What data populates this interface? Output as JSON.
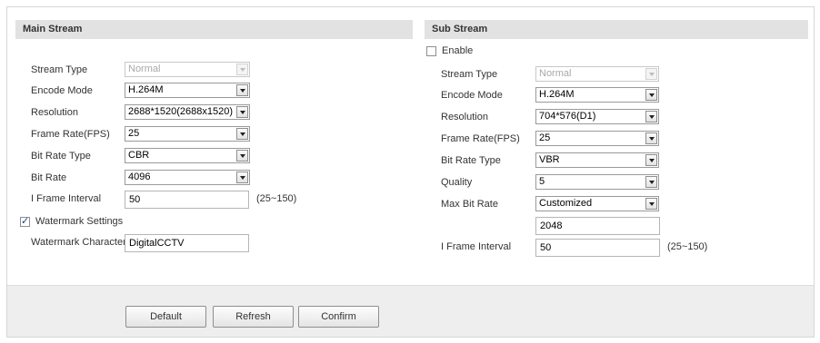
{
  "main_stream": {
    "title": "Main Stream",
    "stream_type": {
      "label": "Stream Type",
      "value": "Normal"
    },
    "encode_mode": {
      "label": "Encode Mode",
      "value": "H.264M"
    },
    "resolution": {
      "label": "Resolution",
      "value": "2688*1520(2688x1520)"
    },
    "frame_rate": {
      "label": "Frame Rate(FPS)",
      "value": "25"
    },
    "bit_rate_type": {
      "label": "Bit Rate Type",
      "value": "CBR"
    },
    "bit_rate": {
      "label": "Bit Rate",
      "value": "4096"
    },
    "i_frame_interval": {
      "label": "I Frame Interval",
      "value": "50",
      "range": "(25~150)"
    },
    "watermark_settings": {
      "label": "Watermark Settings",
      "checked": true
    },
    "watermark_character": {
      "label": "Watermark Character",
      "value": "DigitalCCTV"
    }
  },
  "sub_stream": {
    "title": "Sub Stream",
    "enable": {
      "label": "Enable",
      "checked": false
    },
    "stream_type": {
      "label": "Stream Type",
      "value": "Normal"
    },
    "encode_mode": {
      "label": "Encode Mode",
      "value": "H.264M"
    },
    "resolution": {
      "label": "Resolution",
      "value": "704*576(D1)"
    },
    "frame_rate": {
      "label": "Frame Rate(FPS)",
      "value": "25"
    },
    "bit_rate_type": {
      "label": "Bit Rate Type",
      "value": "VBR"
    },
    "quality": {
      "label": "Quality",
      "value": "5"
    },
    "max_bit_rate": {
      "label": "Max Bit Rate",
      "value": "Customized",
      "custom_value": "2048"
    },
    "i_frame_interval": {
      "label": "I Frame Interval",
      "value": "50",
      "range": "(25~150)"
    }
  },
  "buttons": {
    "default": "Default",
    "refresh": "Refresh",
    "confirm": "Confirm"
  }
}
